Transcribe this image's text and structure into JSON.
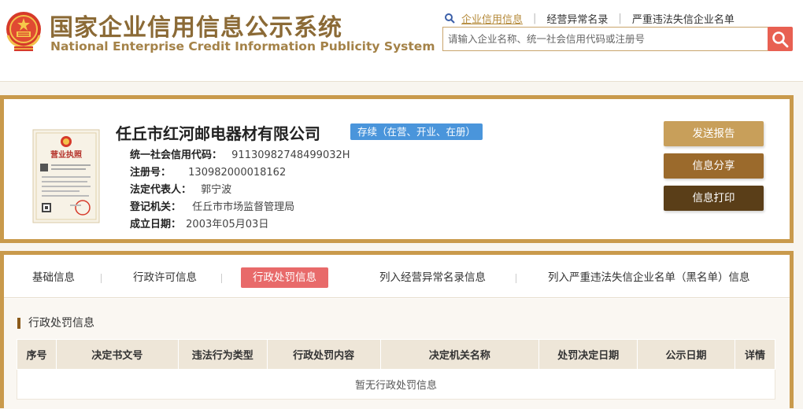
{
  "header": {
    "title_cn": "国家企业信用信息公示系统",
    "title_en": "National Enterprise Credit Information Publicity System",
    "links": [
      {
        "label": "企业信用信息",
        "active": true
      },
      {
        "label": "经营异常名录",
        "active": false
      },
      {
        "label": "严重违法失信企业名单",
        "active": false
      }
    ],
    "search": {
      "placeholder": "请输入企业名称、统一社会信用代码或注册号",
      "value": ""
    }
  },
  "company": {
    "name": "任丘市红河邮电器材有限公司",
    "status": "存续（在营、开业、在册）",
    "license_label": "营业执照",
    "fields": [
      {
        "label": "统一社会信用代码：",
        "value": "91130982748499032H"
      },
      {
        "label": "注册号：",
        "value": "130982000018162"
      },
      {
        "label": "法定代表人：",
        "value": "郭宁波"
      },
      {
        "label": "登记机关：",
        "value": "任丘市市场监督管理局"
      },
      {
        "label": "成立日期：",
        "value": "2003年05月03日"
      }
    ],
    "actions": {
      "send": "发送报告",
      "share": "信息分享",
      "print": "信息打印"
    }
  },
  "tabs": [
    {
      "label": "基础信息",
      "active": false
    },
    {
      "label": "行政许可信息",
      "active": false
    },
    {
      "label": "行政处罚信息",
      "active": true
    },
    {
      "label": "列入经营异常名录信息",
      "active": false
    },
    {
      "label": "列入严重违法失信企业名单（黑名单）信息",
      "active": false
    }
  ],
  "section": {
    "title": "行政处罚信息",
    "columns": [
      "序号",
      "决定书文号",
      "违法行为类型",
      "行政处罚内容",
      "决定机关名称",
      "处罚决定日期",
      "公示日期",
      "详情"
    ],
    "empty_text": "暂无行政处罚信息"
  },
  "colors": {
    "brand": "#8b6a36",
    "badge": "#4a95db",
    "active_tab": "#e86a6a",
    "search_button": "#e86052"
  }
}
